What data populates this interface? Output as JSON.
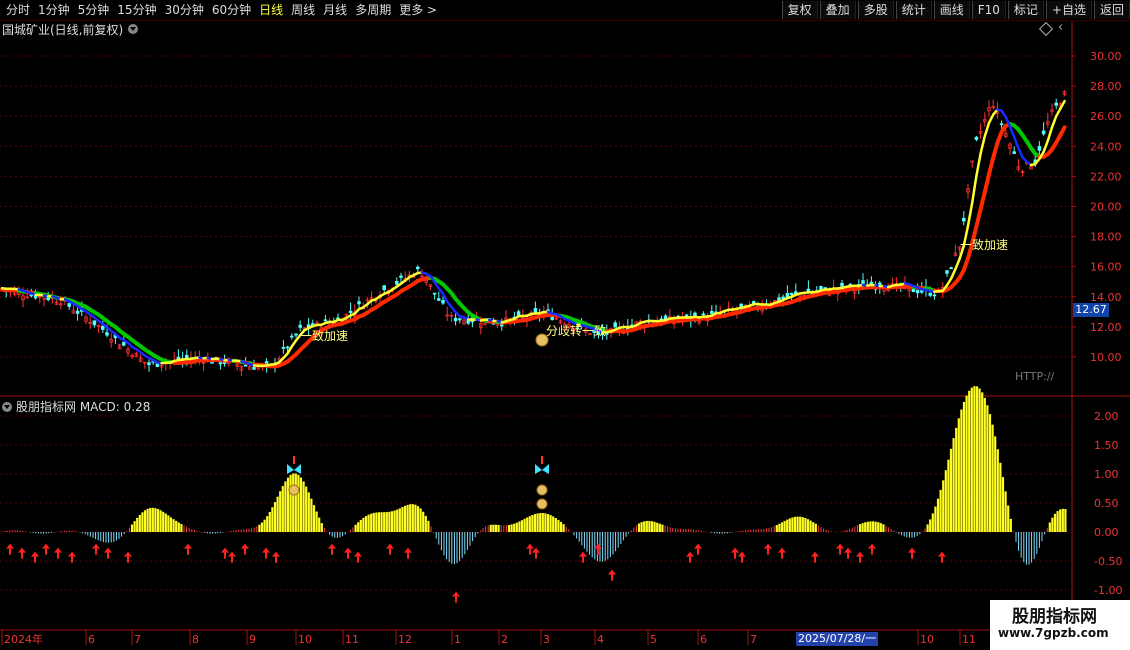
{
  "toolbar": {
    "periods": [
      "分时",
      "1分钟",
      "5分钟",
      "15分钟",
      "30分钟",
      "60分钟",
      "日线",
      "周线",
      "月线",
      "多周期",
      "更多 >"
    ],
    "active_period": "日线",
    "tools": [
      "复权",
      "叠加",
      "多股",
      "统计",
      "画线",
      "F10",
      "标记",
      "+自选",
      "返回"
    ]
  },
  "main_title": "国城矿业(日线,前复权)",
  "price_axis": [
    "30.00",
    "28.00",
    "26.00",
    "24.00",
    "22.00",
    "20.00",
    "18.00",
    "16.00",
    "14.00",
    "12.00",
    "10.00"
  ],
  "current_price": "12.67",
  "annotations": {
    "accel1": "一致加速",
    "diverge": "分歧转一致",
    "accel2": "一致加速",
    "http": "HTTP://"
  },
  "macd": {
    "label": "股朋指标网 MACD: 0.28",
    "axis": [
      "2.00",
      "1.50",
      "1.00",
      "0.50",
      "0.00",
      "-0.50",
      "-1.00"
    ]
  },
  "time_axis": [
    "2024年",
    "6",
    "7",
    "8",
    "9",
    "10",
    "11",
    "12",
    "1",
    "2",
    "3",
    "4",
    "5",
    "6",
    "7",
    "2025/07/28/一",
    "10",
    "11"
  ],
  "watermark": {
    "line1": "股朋指标网",
    "line2": "www.7gpzb.com"
  },
  "colors": {
    "up": "#ff3030",
    "down": "#54ffff",
    "ma_yellow": "#ffff30",
    "ma_red": "#ff2a00",
    "ma_green": "#00c800",
    "ma_blue": "#1a2aff",
    "grid": "#5a0000"
  }
}
